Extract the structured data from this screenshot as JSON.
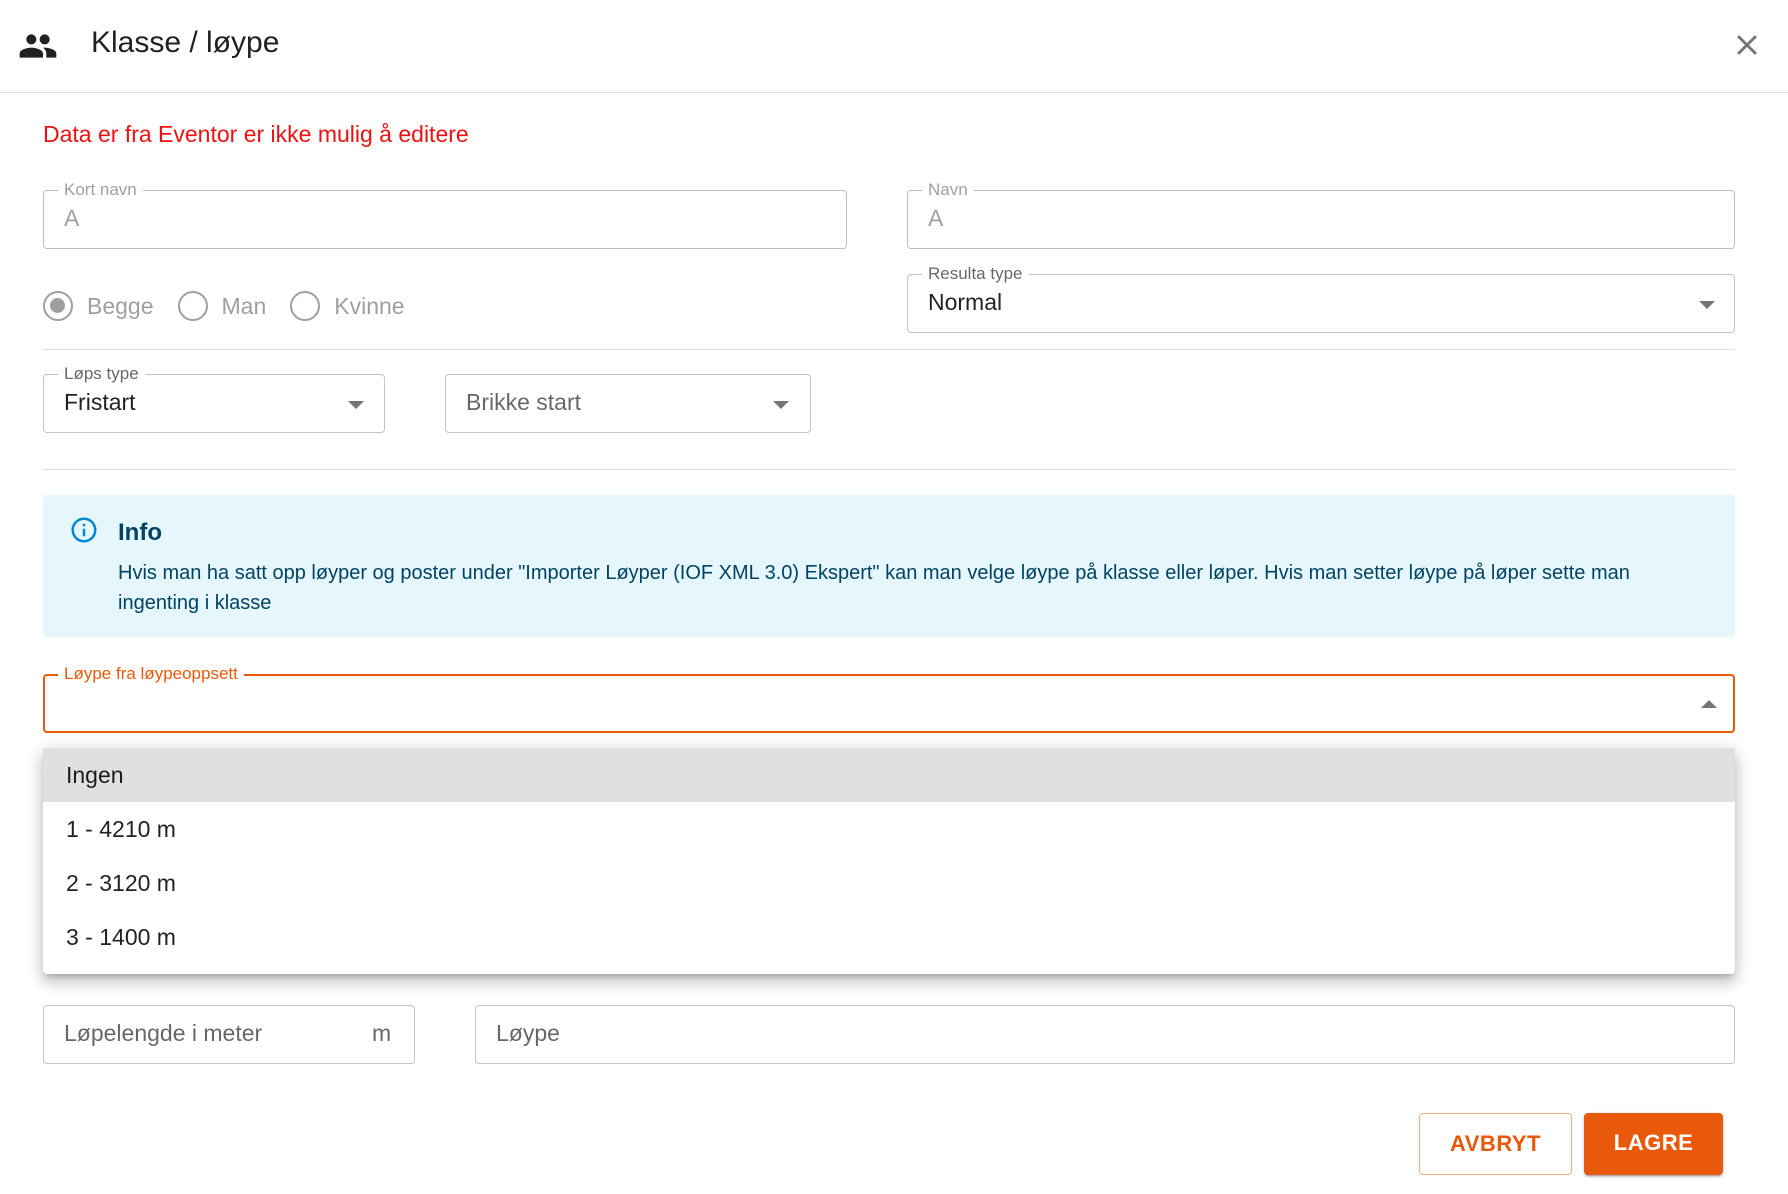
{
  "dialog": {
    "title": "Klasse / løype",
    "warning": "Data er fra Eventor er ikke mulig å editere"
  },
  "fields": {
    "short_name": {
      "label": "Kort navn",
      "value": "A"
    },
    "name": {
      "label": "Navn",
      "value": "A"
    },
    "gender": {
      "options": [
        "Begge",
        "Man",
        "Kvinne"
      ],
      "selected": "Begge"
    },
    "result_type": {
      "label": "Resulta type",
      "value": "Normal"
    },
    "race_type": {
      "label": "Løps type",
      "value": "Fristart"
    },
    "chip_start": {
      "placeholder": "Brikke start"
    },
    "course_from_setup": {
      "label": "Løype fra løypeoppsett",
      "value": ""
    },
    "length": {
      "placeholder": "Løpelengde i meter",
      "unit": "m"
    },
    "course": {
      "placeholder": "Løype"
    }
  },
  "info": {
    "title": "Info",
    "text": "Hvis man ha satt opp løyper og poster under \"Importer Løyper (IOF XML 3.0) Ekspert\" kan man velge løype på klasse eller løper. Hvis man setter løype på løper sette man ingenting i klasse"
  },
  "menu": {
    "items": [
      "Ingen",
      "1 - 4210 m",
      "2 - 3120 m",
      "3 - 1400 m"
    ],
    "highlighted": "Ingen"
  },
  "actions": {
    "cancel": "AVBRYT",
    "save": "LAGRE"
  },
  "colors": {
    "accent": "#e8590c",
    "warning": "#ee1111",
    "info_bg": "#e5f6fd",
    "info_text": "#014361"
  }
}
